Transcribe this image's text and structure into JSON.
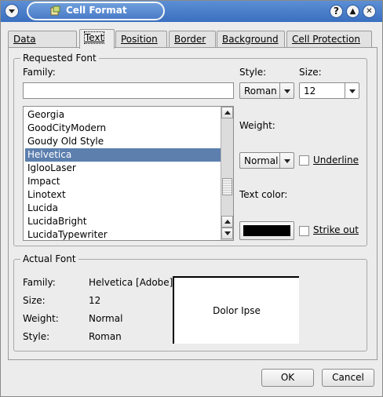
{
  "window": {
    "title": "Cell Format",
    "help_glyph": "?",
    "shade_glyph": "▲",
    "close_glyph": "✕",
    "icons": [
      "menu-icon",
      "app-icon",
      "help-icon",
      "shade-icon",
      "close-icon"
    ]
  },
  "tabs": [
    {
      "label": "Data Format",
      "active": false
    },
    {
      "label": "Text",
      "active": true
    },
    {
      "label": "Position",
      "active": false
    },
    {
      "label": "Border",
      "active": false
    },
    {
      "label": "Background",
      "active": false
    },
    {
      "label": "Cell Protection",
      "active": false
    }
  ],
  "requested_font": {
    "legend": "Requested Font",
    "family_label": "Family:",
    "family_value": "",
    "style_label": "Style:",
    "style_value": "Roman",
    "size_label": "Size:",
    "size_value": "12",
    "weight_label": "Weight:",
    "weight_value": "Normal",
    "underline_label": "Underline",
    "underline_checked": false,
    "text_color_label": "Text color:",
    "text_color": "#000000",
    "strikeout_label": "Strike out",
    "strikeout_checked": false,
    "families": [
      "Georgia",
      "GoodCityModern",
      "Goudy Old Style",
      "Helvetica",
      "IglooLaser",
      "Impact",
      "Linotext",
      "Lucida",
      "LucidaBright",
      "LucidaTypewriter"
    ],
    "selected_family": "Helvetica"
  },
  "actual_font": {
    "legend": "Actual Font",
    "family_label": "Family:",
    "family_value": "Helvetica [Adobe]",
    "size_label": "Size:",
    "size_value": "12",
    "weight_label": "Weight:",
    "weight_value": "Normal",
    "style_label": "Style:",
    "style_value": "Roman",
    "preview_text": "Dolor Ipse"
  },
  "buttons": {
    "ok": "OK",
    "cancel": "Cancel"
  },
  "colors": {
    "title_bar": "#4a7cc8",
    "selection": "#5c7fae"
  }
}
